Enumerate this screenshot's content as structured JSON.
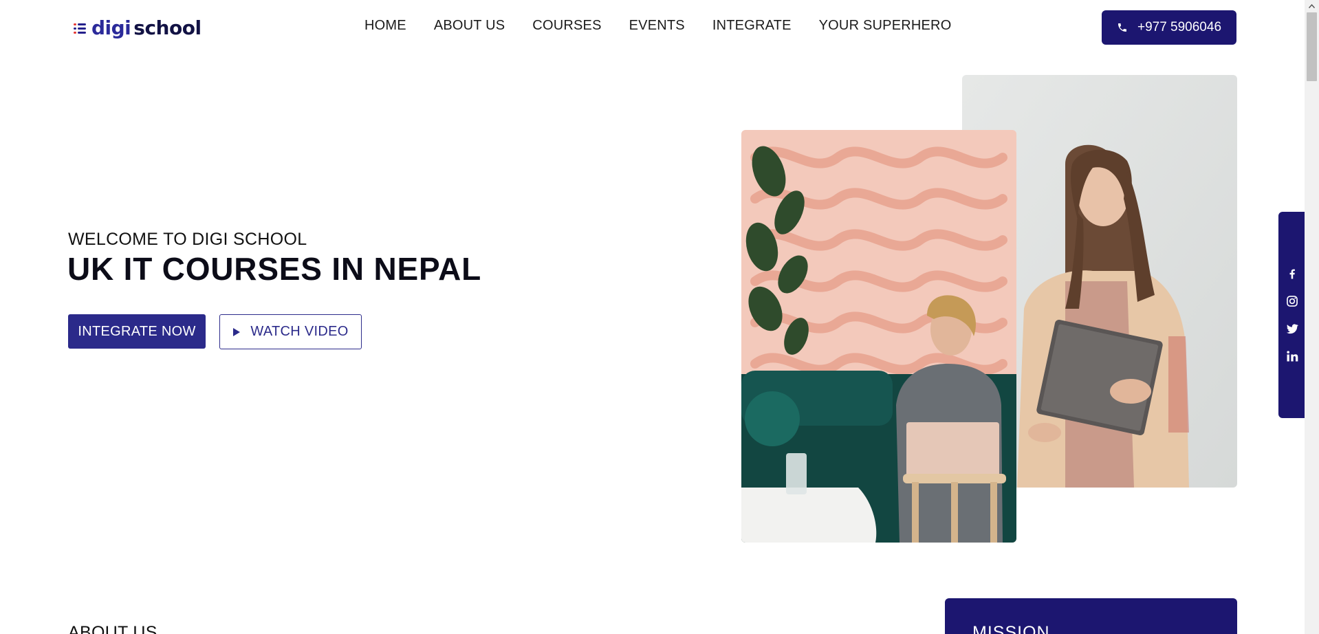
{
  "brand": {
    "part1": "digi",
    "part2": "school",
    "primary_color": "#1c1670",
    "accent_color": "#e53935"
  },
  "nav": [
    {
      "label": "HOME"
    },
    {
      "label": "ABOUT US"
    },
    {
      "label": "COURSES"
    },
    {
      "label": "EVENTS"
    },
    {
      "label": "INTEGRATE"
    },
    {
      "label": "YOUR SUPERHERO"
    }
  ],
  "header": {
    "phone_label": "+977 5906046",
    "phone_icon": "phone-icon"
  },
  "hero": {
    "subtitle": "WELCOME TO DIGI SCHOOL",
    "title": "UK IT COURSES IN NEPAL",
    "primary_button": "INTEGRATE NOW",
    "secondary_button": "WATCH VIDEO",
    "secondary_icon": "play-icon"
  },
  "social": [
    {
      "icon": "facebook-icon"
    },
    {
      "icon": "instagram-icon"
    },
    {
      "icon": "twitter-icon"
    },
    {
      "icon": "linkedin-icon"
    }
  ],
  "about": {
    "heading": "ABOUT US"
  },
  "mission": {
    "title": "MISSION"
  }
}
